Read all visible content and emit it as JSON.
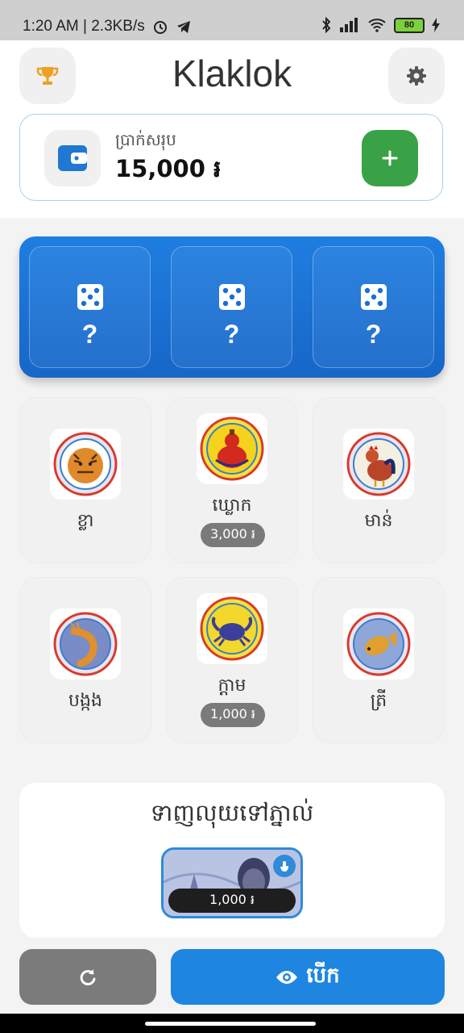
{
  "status_bar": {
    "time": "1:20 AM",
    "speed": "2.3KB/s",
    "battery": "80"
  },
  "header": {
    "title": "Klaklok",
    "wallet_label": "ប្រាក់សរុប",
    "wallet_balance": "15,000 ៛"
  },
  "dice": [
    {
      "value": "?"
    },
    {
      "value": "?"
    },
    {
      "value": "?"
    }
  ],
  "animals": [
    {
      "name": "ខ្លា",
      "bet": ""
    },
    {
      "name": "ឃ្លោក",
      "bet": "3,000 ៛"
    },
    {
      "name": "មាន់",
      "bet": ""
    },
    {
      "name": "បង្កង",
      "bet": ""
    },
    {
      "name": "ក្ដាម",
      "bet": "1,000 ៛"
    },
    {
      "name": "ត្រី",
      "bet": ""
    }
  ],
  "bet_panel": {
    "title": "ទាញលុយទៅភ្នាល់",
    "note_amount": "1,000 ៛"
  },
  "actions": {
    "open_label": "បើក"
  },
  "colors": {
    "primary": "#1e86e0",
    "add_button": "#3aa246",
    "trophy": "#f0a020"
  },
  "icons": [
    "trophy-icon",
    "gear-icon",
    "wallet-icon",
    "plus-icon",
    "dice-icon",
    "refresh-icon",
    "eye-icon",
    "touch-icon"
  ]
}
